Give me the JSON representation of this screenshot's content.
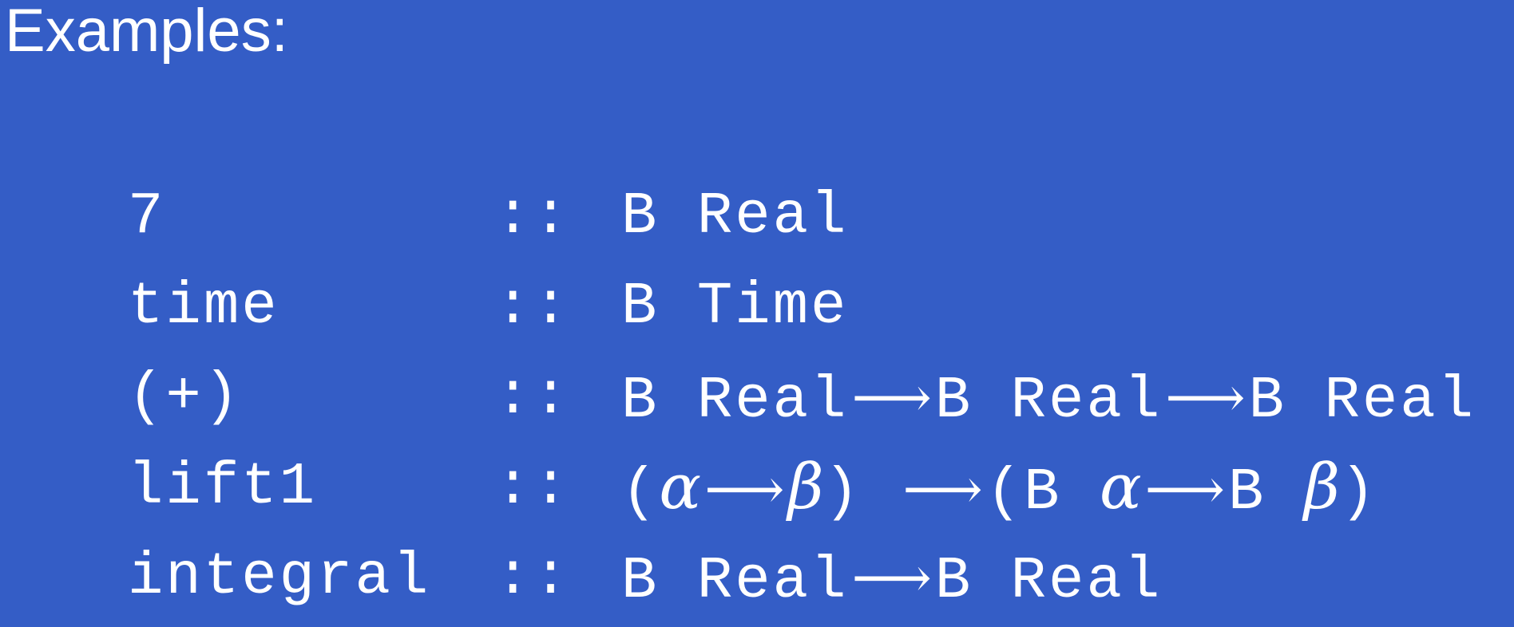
{
  "slide": {
    "title": "Examples:",
    "background_color": "#345dc6",
    "text_color": "#ffffff"
  },
  "examples": [
    {
      "name": "7",
      "separator": "::",
      "type_tokens": [
        {
          "kind": "mono",
          "text": "B Real"
        }
      ]
    },
    {
      "name": "time",
      "separator": "::",
      "type_tokens": [
        {
          "kind": "mono",
          "text": "B Time"
        }
      ]
    },
    {
      "name": "(+)",
      "separator": "::",
      "type_tokens": [
        {
          "kind": "mono",
          "text": "B Real"
        },
        {
          "kind": "arrow",
          "text": "⟶"
        },
        {
          "kind": "mono",
          "text": "B Real"
        },
        {
          "kind": "arrow",
          "text": "⟶"
        },
        {
          "kind": "mono",
          "text": "B Real"
        }
      ]
    },
    {
      "name": "lift1",
      "separator": "::",
      "type_tokens": [
        {
          "kind": "mono",
          "text": "("
        },
        {
          "kind": "greek",
          "text": "α"
        },
        {
          "kind": "arrow",
          "text": "⟶"
        },
        {
          "kind": "greek",
          "text": "β"
        },
        {
          "kind": "mono",
          "text": ") "
        },
        {
          "kind": "arrow",
          "text": "⟶"
        },
        {
          "kind": "mono",
          "text": "(B "
        },
        {
          "kind": "greek",
          "text": "α"
        },
        {
          "kind": "arrow",
          "text": "⟶"
        },
        {
          "kind": "mono",
          "text": "B "
        },
        {
          "kind": "greek",
          "text": "β"
        },
        {
          "kind": "mono",
          "text": ")"
        }
      ]
    },
    {
      "name": "integral",
      "separator": "::",
      "type_tokens": [
        {
          "kind": "mono",
          "text": "B Real"
        },
        {
          "kind": "arrow",
          "text": "⟶"
        },
        {
          "kind": "mono",
          "text": "B Real"
        }
      ]
    }
  ]
}
